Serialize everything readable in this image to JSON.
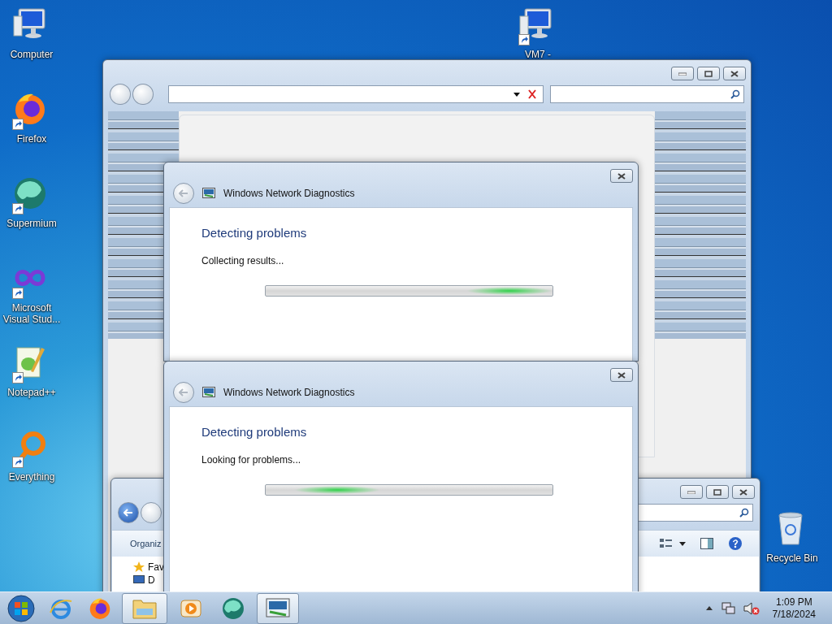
{
  "desktop": {
    "left_icons": [
      {
        "kind": "computer",
        "label": "Computer",
        "shortcut": false
      },
      {
        "kind": "firefox",
        "label": "Firefox",
        "shortcut": true
      },
      {
        "kind": "supermium",
        "label": "Supermium",
        "shortcut": true
      },
      {
        "kind": "visual-studio",
        "label": "Microsoft Visual Stud...",
        "shortcut": true
      },
      {
        "kind": "notepad",
        "label": "Notepad++",
        "shortcut": true
      },
      {
        "kind": "everything",
        "label": "Everything",
        "shortcut": true
      }
    ],
    "top_icon": {
      "kind": "computer",
      "label": "VM7 -",
      "shortcut": true
    },
    "corner_icon": {
      "kind": "recycle-bin",
      "label": "Recycle Bin",
      "shortcut": false
    }
  },
  "explorer_window": {
    "toolbar_label": "Organiz",
    "nav_items": [
      {
        "kind": "star",
        "label": "Fav"
      },
      {
        "kind": "monitor",
        "label": "D"
      }
    ]
  },
  "dialogs": [
    {
      "title": "Windows Network Diagnostics",
      "heading": "Detecting problems",
      "status": "Collecting results...",
      "level": 0.85
    },
    {
      "title": "Windows Network Diagnostics",
      "heading": "Detecting problems",
      "status": "Looking for problems...",
      "level": 0.25
    }
  ],
  "taskbar": {
    "items": [
      {
        "kind": "start",
        "selected": false
      },
      {
        "kind": "ie",
        "selected": false
      },
      {
        "kind": "firefox",
        "selected": false
      },
      {
        "kind": "explorer",
        "selected": true
      },
      {
        "kind": "media-player",
        "selected": false
      },
      {
        "kind": "supermium",
        "selected": false
      },
      {
        "kind": "diagnostics",
        "selected": true
      }
    ],
    "tray": [
      {
        "kind": "caret"
      },
      {
        "kind": "network"
      },
      {
        "kind": "volume-muted"
      }
    ],
    "clock": {
      "time": "1:09 PM",
      "date": "7/18/2024"
    }
  }
}
